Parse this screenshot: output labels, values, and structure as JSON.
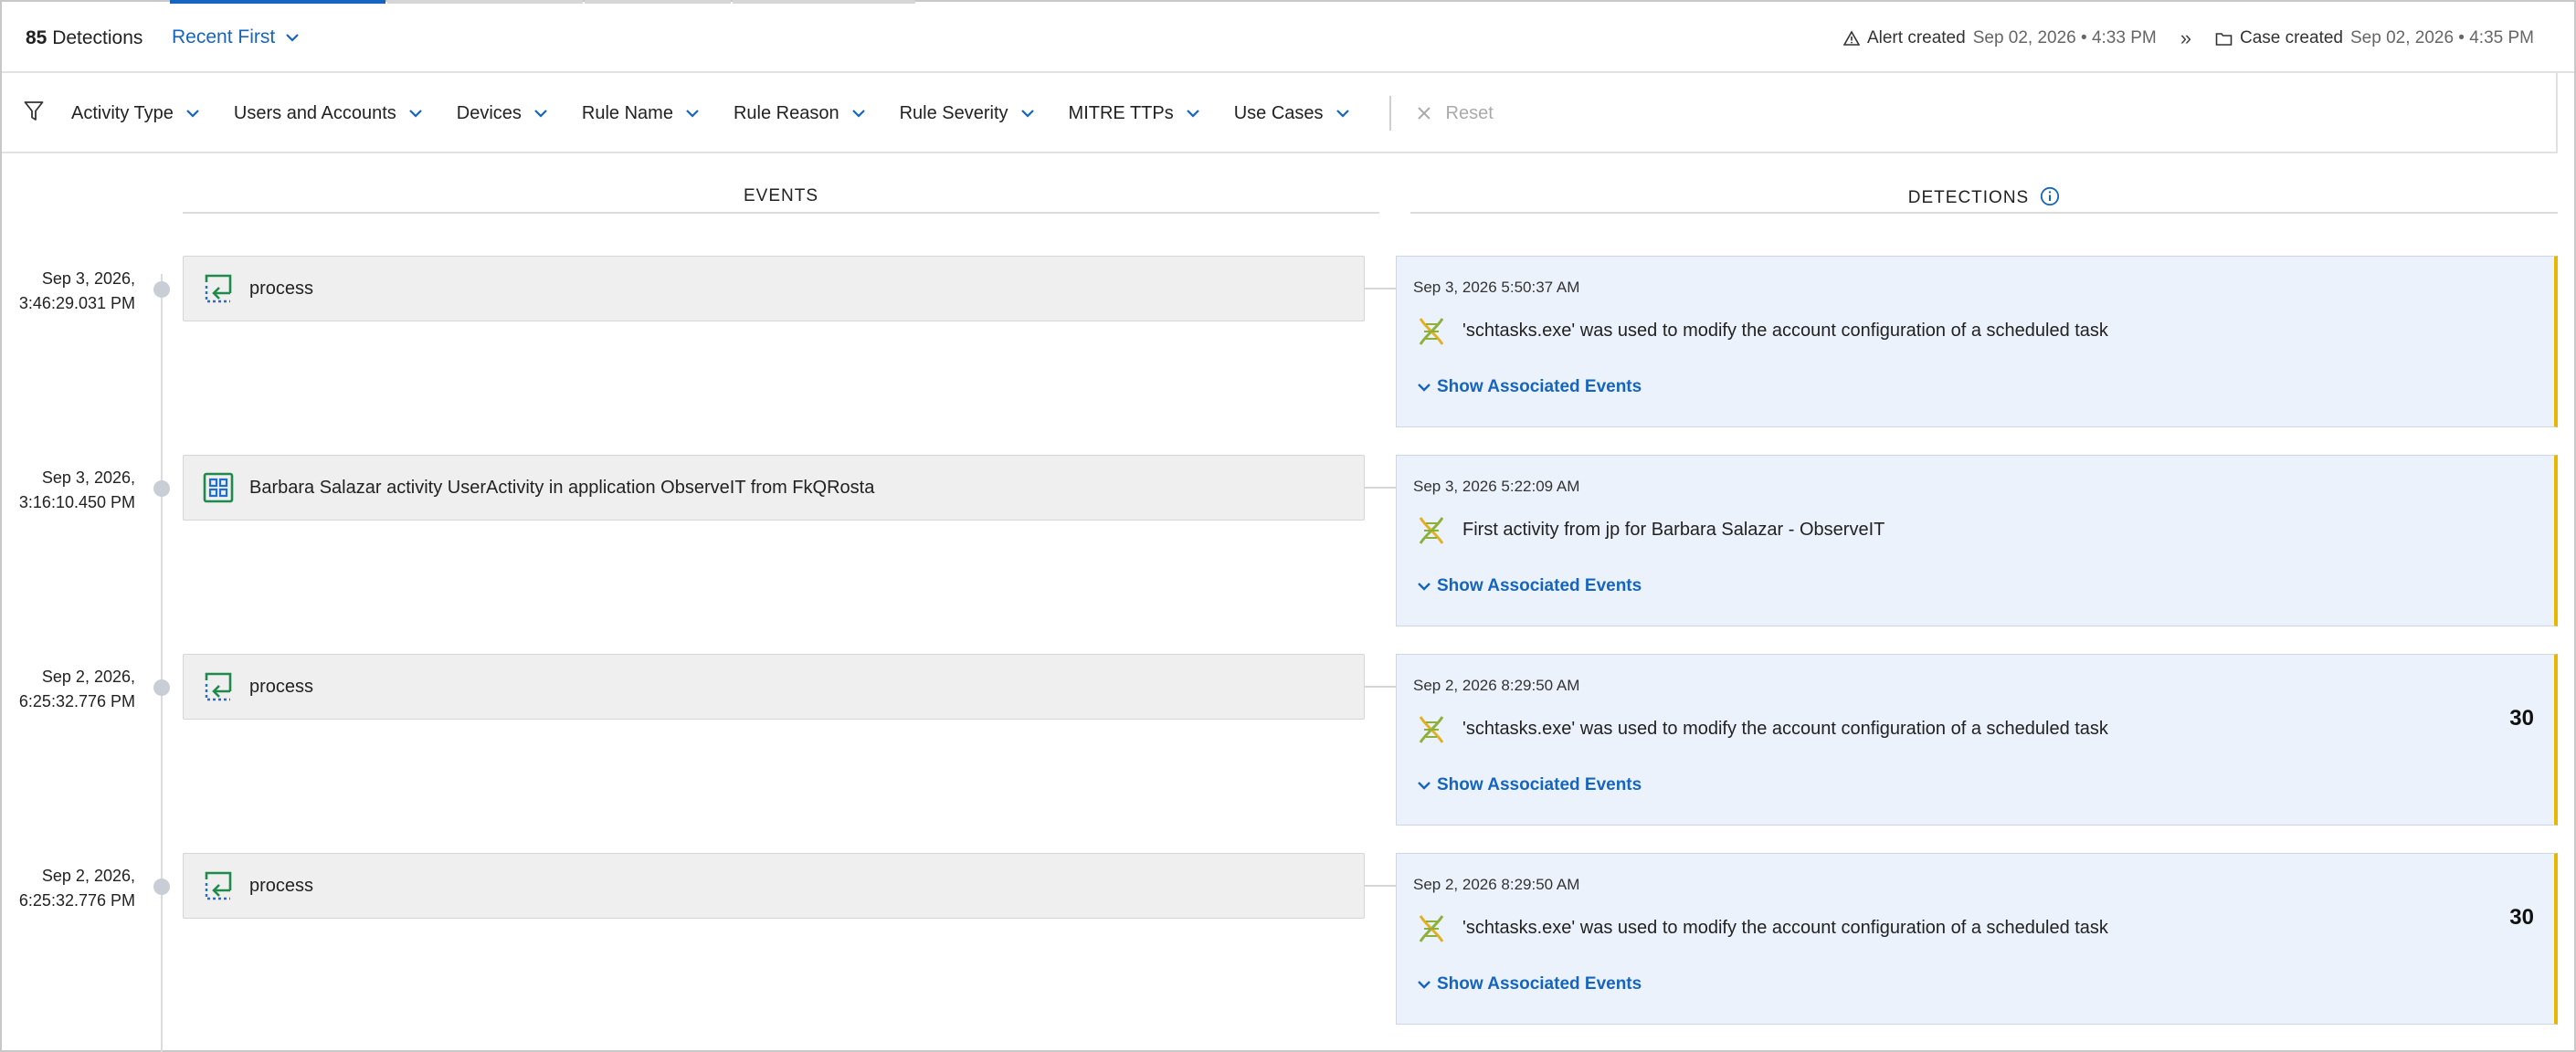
{
  "header": {
    "detections_count": "85",
    "detections_label": "Detections",
    "sort_label": "Recent First",
    "alert_label": "Alert created",
    "alert_time": "Sep 02, 2026 • 4:33 PM",
    "arrow": "»",
    "case_label": "Case created",
    "case_time": "Sep 02, 2026 • 4:35 PM"
  },
  "filters": [
    {
      "label": "Activity Type"
    },
    {
      "label": "Users and Accounts"
    },
    {
      "label": "Devices"
    },
    {
      "label": "Rule Name"
    },
    {
      "label": "Rule Reason"
    },
    {
      "label": "Rule Severity"
    },
    {
      "label": "MITRE TTPs"
    },
    {
      "label": "Use Cases"
    }
  ],
  "reset_label": "Reset",
  "columns": {
    "events": "EVENTS",
    "detections": "DETECTIONS"
  },
  "rows": [
    {
      "ts_date": "Sep 3, 2026,",
      "ts_time": "3:46:29.031 PM",
      "event_icon": "process-icon",
      "event_text": "process",
      "det_time": "Sep 3, 2026 5:50:37 AM",
      "det_text": "'schtasks.exe' was used to modify the account configuration of a scheduled task",
      "show_label": "Show Associated Events",
      "score": ""
    },
    {
      "ts_date": "Sep 3, 2026,",
      "ts_time": "3:16:10.450 PM",
      "event_icon": "app-grid-icon",
      "event_text": "Barbara Salazar activity UserActivity in application ObserveIT from FkQRosta",
      "det_time": "Sep 3, 2026 5:22:09 AM",
      "det_text": "First activity from jp for Barbara Salazar - ObserveIT",
      "show_label": "Show Associated Events",
      "score": ""
    },
    {
      "ts_date": "Sep 2, 2026,",
      "ts_time": "6:25:32.776 PM",
      "event_icon": "process-icon",
      "event_text": "process",
      "det_time": "Sep 2, 2026 8:29:50 AM",
      "det_text": "'schtasks.exe' was used to modify the account configuration of a scheduled task",
      "show_label": "Show Associated Events",
      "score": "30"
    },
    {
      "ts_date": "Sep 2, 2026,",
      "ts_time": "6:25:32.776 PM",
      "event_icon": "process-icon",
      "event_text": "process",
      "det_time": "Sep 2, 2026 8:29:50 AM",
      "det_text": "'schtasks.exe' was used to modify the account configuration of a scheduled task",
      "show_label": "Show Associated Events",
      "score": "30"
    }
  ],
  "colors": {
    "accent": "#1565c0",
    "detection_bg": "#ebf2fb",
    "severity_bar": "#e6b800",
    "event_bg": "#efefef"
  }
}
